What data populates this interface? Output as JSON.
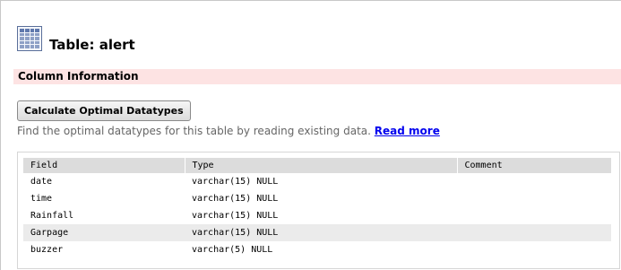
{
  "header": {
    "title": "Table: alert",
    "icon": "table-icon"
  },
  "section": {
    "title": "Column Information",
    "bar_color": "#fde3e3"
  },
  "actions": {
    "calculate_label": "Calculate Optimal Datatypes"
  },
  "help": {
    "text": "Find the optimal datatypes for this table by reading existing data.",
    "link_text": "Read more"
  },
  "columns_table": {
    "headers": [
      "Field",
      "Type",
      "Comment"
    ],
    "rows": [
      {
        "field": "date",
        "type": "varchar(15) NULL",
        "comment": ""
      },
      {
        "field": "time",
        "type": "varchar(15) NULL",
        "comment": ""
      },
      {
        "field": "Rainfall",
        "type": "varchar(15) NULL",
        "comment": ""
      },
      {
        "field": "Garpage",
        "type": "varchar(15) NULL",
        "comment": ""
      },
      {
        "field": "buzzer",
        "type": "varchar(5) NULL",
        "comment": ""
      }
    ]
  }
}
